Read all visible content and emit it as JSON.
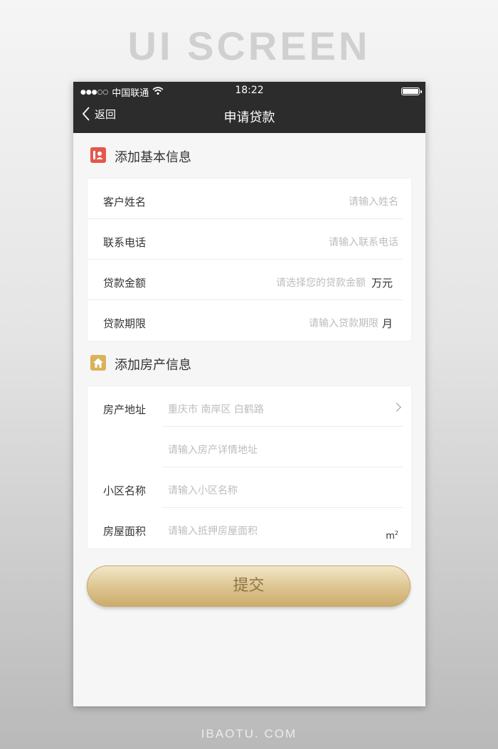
{
  "banner": {
    "text": "UI SCREEN"
  },
  "footer": {
    "text": "IBAOTU. COM"
  },
  "status": {
    "carrier": "中国联通",
    "time": "18:22"
  },
  "nav": {
    "back": "返回",
    "title": "申请贷款"
  },
  "sections": {
    "basic": {
      "title": "添加基本信息",
      "icon": "contact-card-icon",
      "rows": [
        {
          "label": "客户姓名",
          "placeholder": "请输入姓名"
        },
        {
          "label": "联系电话",
          "placeholder": "请输入联系电话"
        },
        {
          "label": "贷款金额",
          "placeholder": "请选择您的贷款金额",
          "unit": "万元"
        },
        {
          "label": "贷款期限",
          "placeholder": "请输入贷款期限",
          "unit": "月"
        }
      ]
    },
    "property": {
      "title": "添加房产信息",
      "icon": "house-icon",
      "rows": [
        {
          "label": "房产地址",
          "placeholder": "重庆市 南岸区 白鹤路"
        },
        {
          "label": "",
          "placeholder": "请输入房产详情地址"
        },
        {
          "label": "小区名称",
          "placeholder": "请输入小区名称"
        },
        {
          "label": "房屋面积",
          "placeholder": "请输入抵押房屋面积",
          "unit": "m",
          "unit_sup": "2"
        }
      ]
    }
  },
  "submit": {
    "label": "提交"
  },
  "colors": {
    "accent": "#d9b25a",
    "topbar": "#2c2c2c",
    "basic_icon": "#e4574d"
  }
}
